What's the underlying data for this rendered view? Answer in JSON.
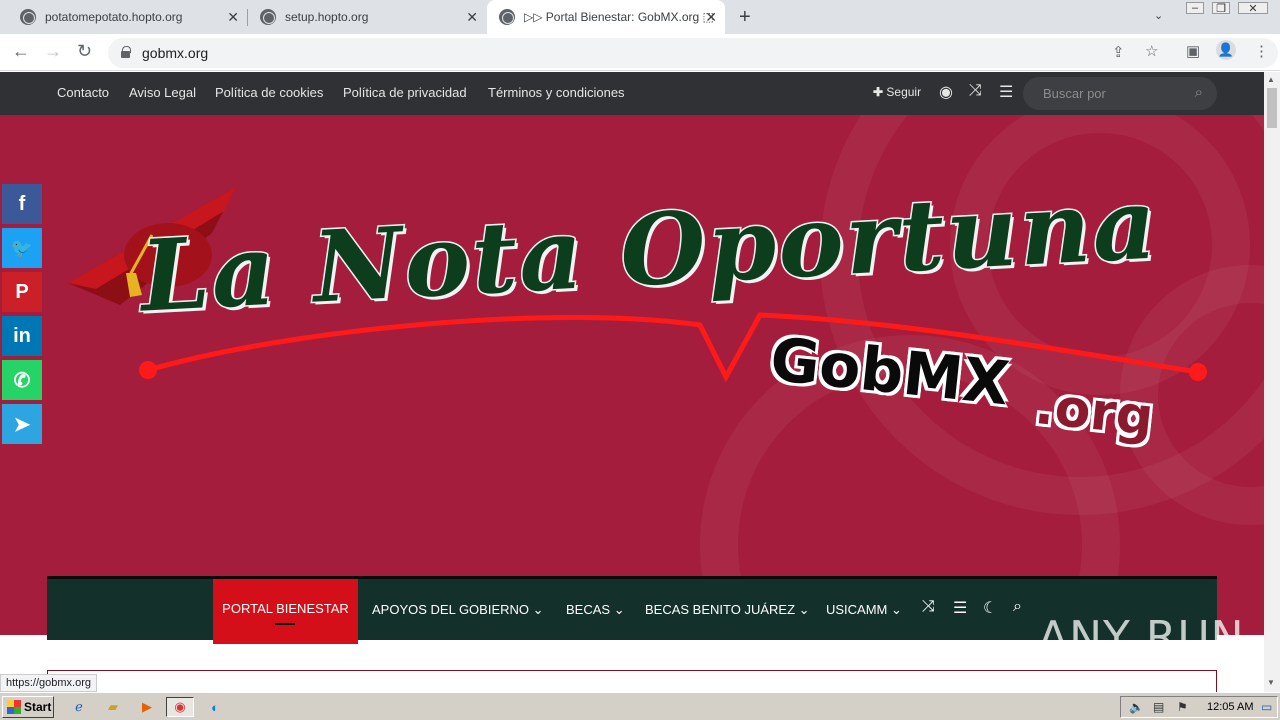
{
  "browser": {
    "tabs": [
      {
        "title": "potatomepotato.hopto.org"
      },
      {
        "title": "setup.hopto.org"
      },
      {
        "title": "▷▷ Portal Bienestar: GobMX.org ⬚"
      }
    ],
    "url": "gobmx.org"
  },
  "topbar": {
    "links": [
      "Contacto",
      "Aviso Legal",
      "Política de cookies",
      "Política de privacidad",
      "Términos y condiciones"
    ],
    "follow_label": "Seguir",
    "search_placeholder": "Buscar por"
  },
  "logo": {
    "title": "La Nota Oportuna",
    "sub_main": "GobMX",
    "sub_ext": ".org"
  },
  "social": [
    {
      "name": "facebook",
      "glyph": "f",
      "color": "#3b5998"
    },
    {
      "name": "twitter",
      "glyph": "🐦",
      "color": "#1da1f2"
    },
    {
      "name": "pinterest",
      "glyph": "P",
      "color": "#cb2027"
    },
    {
      "name": "linkedin",
      "glyph": "in",
      "color": "#0077b5"
    },
    {
      "name": "whatsapp",
      "glyph": "✆",
      "color": "#25d366"
    },
    {
      "name": "telegram",
      "glyph": "➤",
      "color": "#2ca5e0"
    }
  ],
  "mainnav": {
    "active": "PORTAL BIENESTAR",
    "items": [
      "APOYOS DEL GOBIERNO",
      "BECAS",
      "BECAS BENITO JUÁREZ",
      "USICAMM"
    ]
  },
  "status_url": "https://gobmx.org",
  "watermark": "ANY RUN",
  "taskbar": {
    "start_label": "Start",
    "clock": "12:05 AM"
  }
}
